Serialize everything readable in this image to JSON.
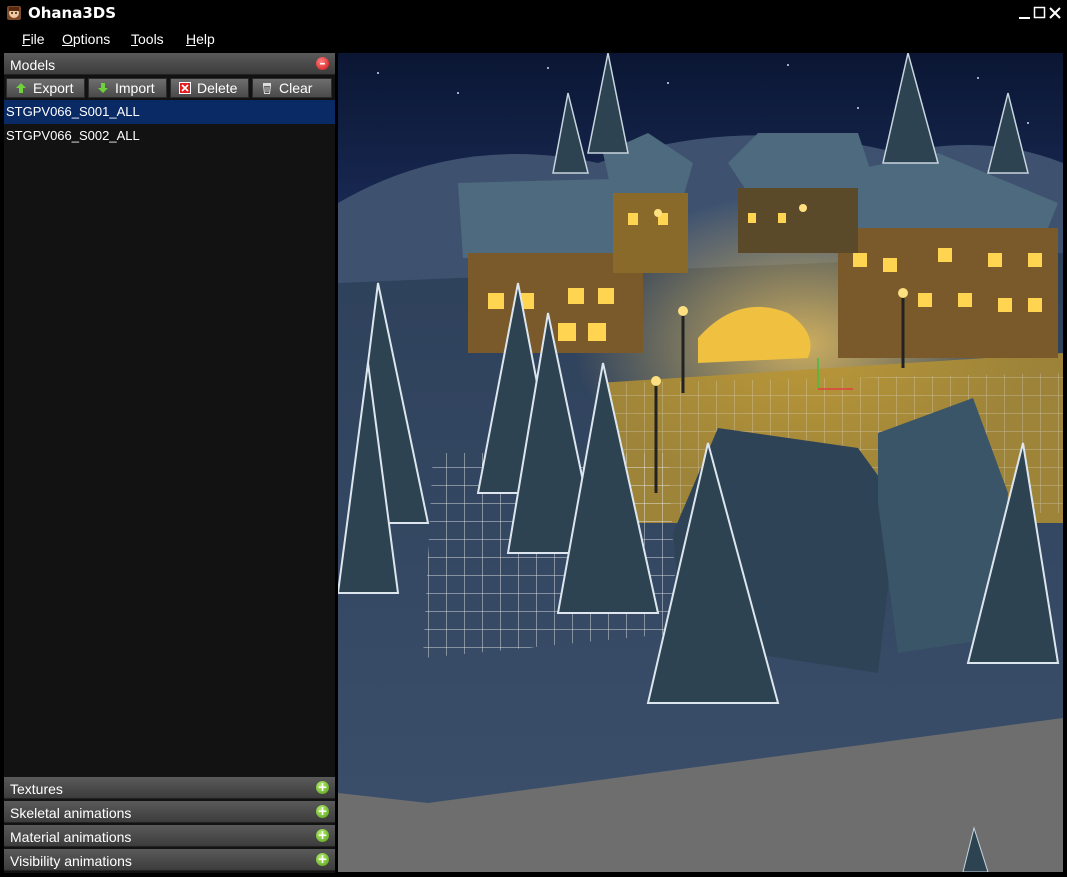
{
  "window": {
    "title": "Ohana3DS"
  },
  "menu": [
    {
      "label": "File",
      "accel": "F",
      "rest": "ile"
    },
    {
      "label": "Options",
      "accel": "O",
      "rest": "ptions"
    },
    {
      "label": "Tools",
      "accel": "T",
      "rest": "ools"
    },
    {
      "label": "Help",
      "accel": "H",
      "rest": "elp"
    }
  ],
  "models_panel": {
    "title": "Models",
    "toolbar": {
      "export_label": "Export",
      "import_label": "Import",
      "delete_label": "Delete",
      "clear_label": "Clear"
    },
    "items": [
      {
        "label": "STGPV066_S001_ALL",
        "selected": true
      },
      {
        "label": "STGPV066_S002_ALL",
        "selected": false
      }
    ]
  },
  "collapsed_panels": [
    {
      "label": "Textures"
    },
    {
      "label": "Skeletal animations"
    },
    {
      "label": "Material animations"
    },
    {
      "label": "Visibility animations"
    }
  ],
  "icons": {
    "app": "ohana-app-icon",
    "export": "arrow-up-icon",
    "import": "arrow-down-icon",
    "delete": "delete-x-icon",
    "clear": "trash-icon",
    "collapse": "minus-circle-icon",
    "expand": "plus-circle-icon"
  },
  "colors": {
    "selection": "#0a2a66",
    "panel_bg": "#121212",
    "minus_red": "#d01010",
    "plus_green": "#4f9a14"
  }
}
